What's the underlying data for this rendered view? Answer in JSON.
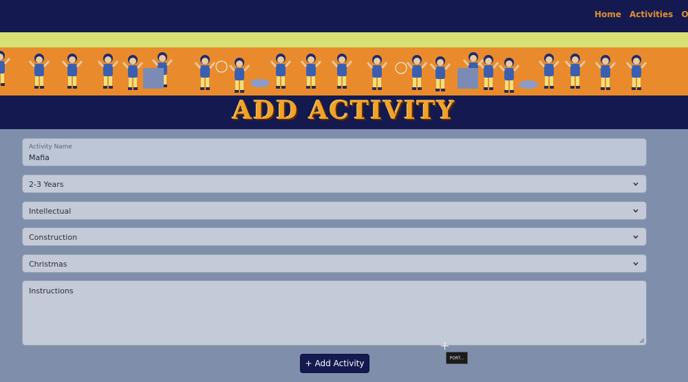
{
  "nav": {
    "links": [
      "Home",
      "Activities",
      "Occas"
    ]
  },
  "header": {
    "title": "ADD ACTIVITY"
  },
  "form": {
    "activity_name": {
      "label": "Activity Name",
      "value": "Mafia"
    },
    "age_select": {
      "value": "2-3 Years"
    },
    "category_select": {
      "value": "Intellectual"
    },
    "type_select": {
      "value": "Construction"
    },
    "occasion_select": {
      "value": "Christmas"
    },
    "instructions": {
      "placeholder": "Instructions"
    },
    "submit": {
      "icon": "+",
      "label": "Add Activity"
    }
  },
  "tooltip": {
    "text": "PORT..."
  },
  "colors": {
    "nav_bg": "#141a4f",
    "accent_orange": "#e98b2c",
    "band_yellow": "#d7e173",
    "page_bg": "#7f8fab",
    "title_orange": "#f2a12a"
  }
}
